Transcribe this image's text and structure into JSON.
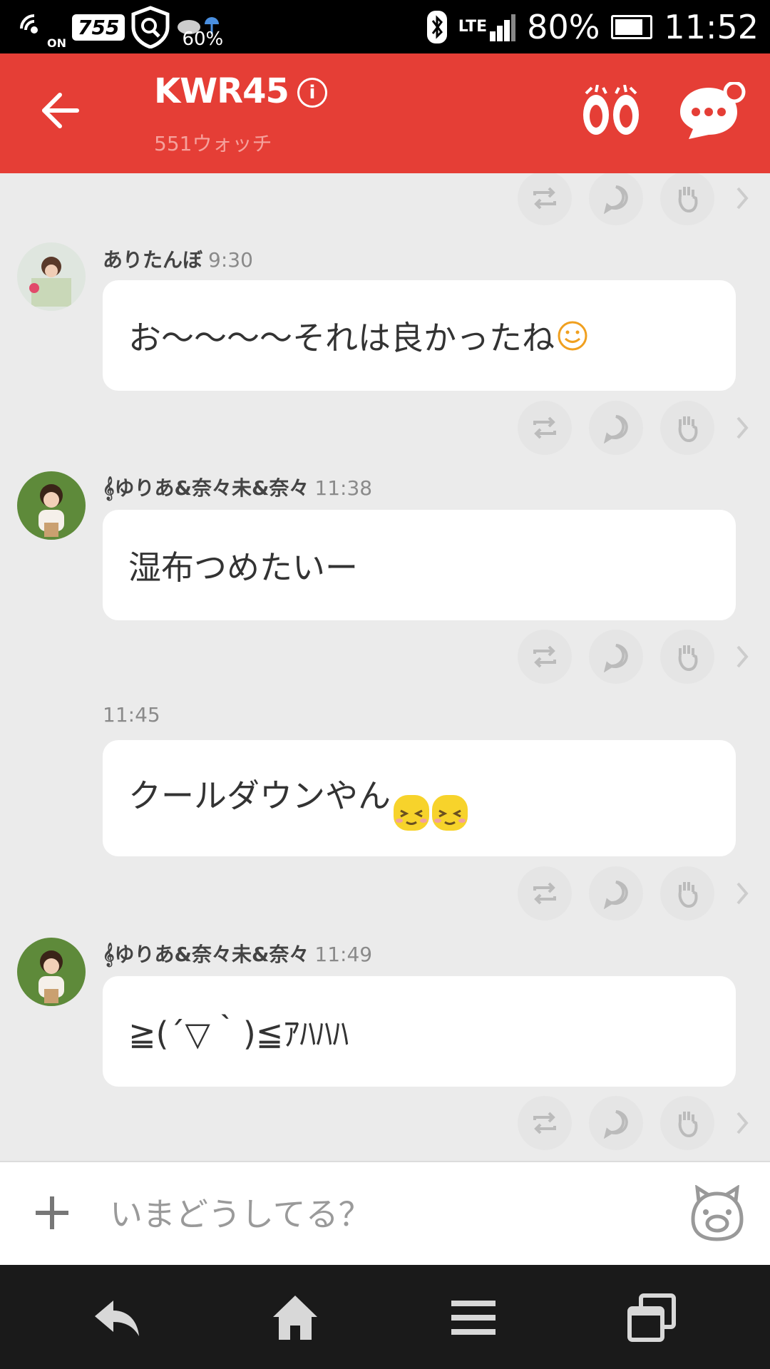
{
  "status": {
    "nfc": "ON",
    "badge": "755",
    "weather_pct": "60%",
    "network": "LTE",
    "battery": "80%",
    "time": "11:52"
  },
  "header": {
    "title": "KWR45",
    "info_icon_text": "i",
    "subtitle": "551ウォッチ",
    "accent_color": "#e53e36"
  },
  "messages": [
    {
      "author": "ありたんぼ",
      "time": "9:30",
      "text": "お〜〜〜〜それは良かったね",
      "emoji": "☺"
    },
    {
      "author": "𝄞ゆりあ&奈々未&奈々",
      "time": "11:38",
      "text": "湿布つめたいー"
    },
    {
      "author": "",
      "time": "11:45",
      "text": "クールダウンやん",
      "emoji": "blush-face x2"
    },
    {
      "author": "𝄞ゆりあ&奈々未&奈々",
      "time": "11:49",
      "text": "≧(´▽｀)≦ｱﾊﾊﾊ"
    }
  ],
  "actions": [
    "repost-icon",
    "reply-icon",
    "applause-icon",
    "chevron-right-icon"
  ],
  "composer": {
    "placeholder": "いまどうしてる？"
  },
  "navbar": [
    "back-icon",
    "home-icon",
    "menu-icon",
    "recent-apps-icon"
  ]
}
